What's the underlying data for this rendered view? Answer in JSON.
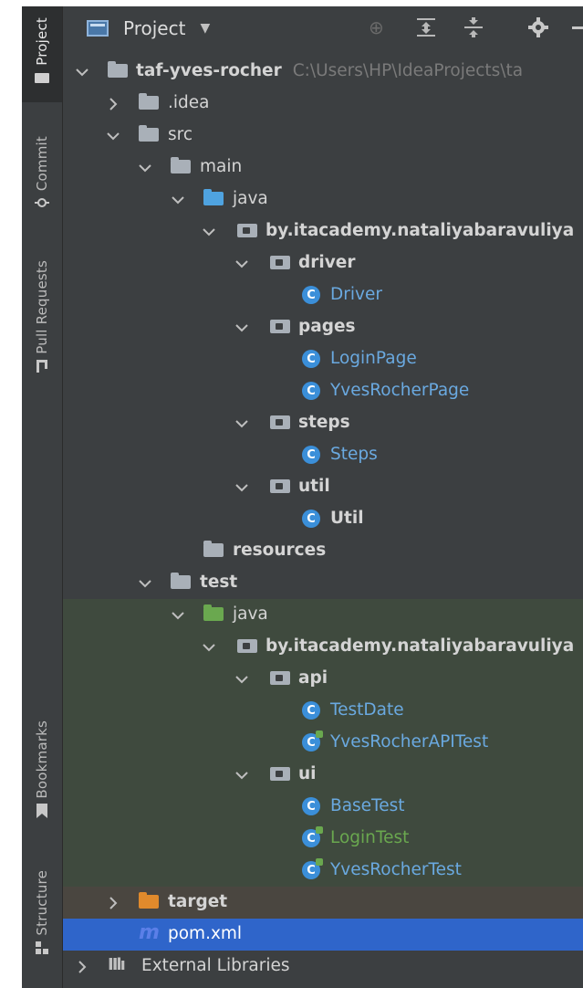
{
  "sidebar": {
    "project_tab": "Project",
    "commit_tab": "Commit",
    "pull_requests_tab": "Pull Requests",
    "bookmarks_tab": "Bookmarks",
    "structure_tab": "Structure"
  },
  "header": {
    "title": "Project"
  },
  "tree": {
    "root": {
      "label": "taf-yves-rocher",
      "path": "C:\\Users\\HP\\IdeaProjects\\ta"
    },
    "idea": ".idea",
    "src": "src",
    "main": "main",
    "main_java": "java",
    "main_package": "by.itacademy.nataliyabaravuliya",
    "driver": "driver",
    "driver_class": "Driver",
    "pages": "pages",
    "login_page": "LoginPage",
    "yves_rocher_page": "YvesRocherPage",
    "steps": "steps",
    "steps_class": "Steps",
    "util": "util",
    "util_class": "Util",
    "resources": "resources",
    "test": "test",
    "test_java": "java",
    "test_package": "by.itacademy.nataliyabaravuliya",
    "api": "api",
    "test_date": "TestDate",
    "api_test": "YvesRocherAPITest",
    "ui": "ui",
    "base_test": "BaseTest",
    "login_test": "LoginTest",
    "yves_rocher_test": "YvesRocherTest",
    "target": "target",
    "pom": "pom.xml",
    "external_libraries": "External Libraries"
  },
  "colors": {
    "background": "#3c3f41",
    "selected_row": "#2f65ca",
    "test_background": "#3f4a3e",
    "class_icon": "#3b8fd9",
    "test_folder": "#6aa84f",
    "target_folder": "#e08a2c"
  }
}
